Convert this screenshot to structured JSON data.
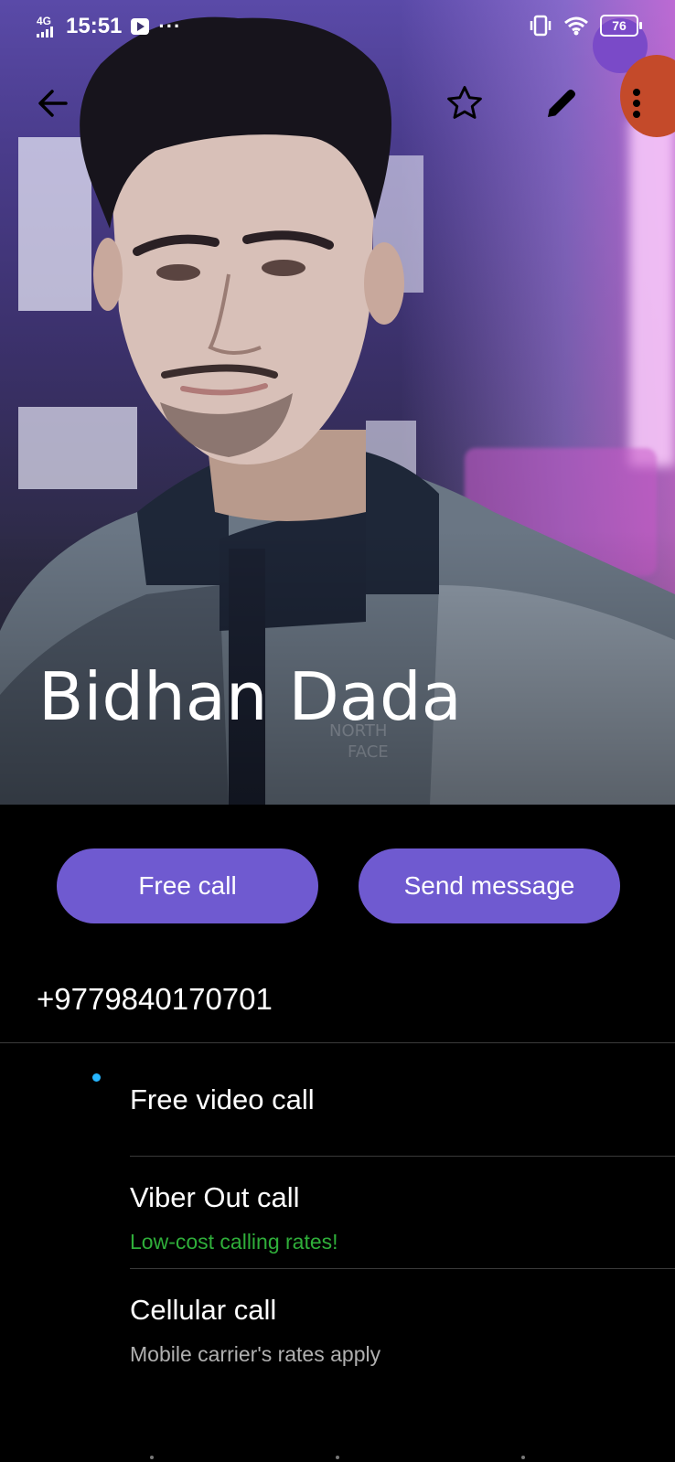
{
  "status_bar": {
    "network": "4G",
    "time": "15:51",
    "more": "···",
    "battery": "76"
  },
  "toolbar": {
    "back_icon": "arrow-left-icon",
    "favorite_icon": "star-outline-icon",
    "edit_icon": "pencil-icon",
    "more_icon": "more-vertical-icon"
  },
  "contact": {
    "name": "Bidhan Dada",
    "phone": "+9779840170701"
  },
  "actions": {
    "free_call": "Free call",
    "send_message": "Send message"
  },
  "options": [
    {
      "title": "Free video call",
      "subtitle": ""
    },
    {
      "title": "Viber Out call",
      "subtitle": "Low-cost calling rates!"
    },
    {
      "title": "Cellular call",
      "subtitle": "Mobile carrier's rates apply"
    }
  ],
  "colors": {
    "accent": "#6f5ad0",
    "viber_out_green": "#2fae3a",
    "indicator_blue": "#26b6ff"
  }
}
